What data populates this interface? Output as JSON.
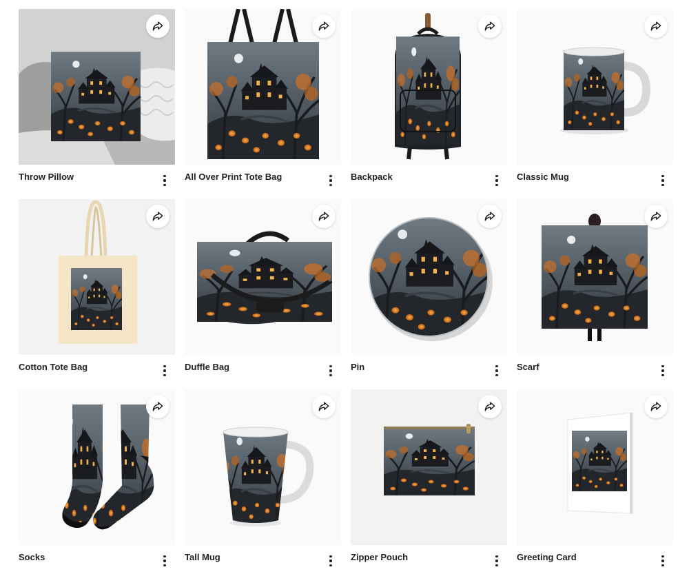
{
  "theme": {
    "title_color": "#222222",
    "art_sky": "#5b6670",
    "art_dark": "#1d1f24",
    "art_orange": "#e07a1f",
    "art_window": "#f2b24a"
  },
  "products": [
    {
      "title": "Throw Pillow",
      "share_icon": "share-arrow-icon",
      "menu_icon": "more-vertical-icon"
    },
    {
      "title": "All Over Print Tote Bag",
      "share_icon": "share-arrow-icon",
      "menu_icon": "more-vertical-icon"
    },
    {
      "title": "Backpack",
      "share_icon": "share-arrow-icon",
      "menu_icon": "more-vertical-icon"
    },
    {
      "title": "Classic Mug",
      "share_icon": "share-arrow-icon",
      "menu_icon": "more-vertical-icon"
    },
    {
      "title": "Cotton Tote Bag",
      "share_icon": "share-arrow-icon",
      "menu_icon": "more-vertical-icon"
    },
    {
      "title": "Duffle Bag",
      "share_icon": "share-arrow-icon",
      "menu_icon": "more-vertical-icon"
    },
    {
      "title": "Pin",
      "share_icon": "share-arrow-icon",
      "menu_icon": "more-vertical-icon"
    },
    {
      "title": "Scarf",
      "share_icon": "share-arrow-icon",
      "menu_icon": "more-vertical-icon"
    },
    {
      "title": "Socks",
      "share_icon": "share-arrow-icon",
      "menu_icon": "more-vertical-icon"
    },
    {
      "title": "Tall Mug",
      "share_icon": "share-arrow-icon",
      "menu_icon": "more-vertical-icon"
    },
    {
      "title": "Zipper Pouch",
      "share_icon": "share-arrow-icon",
      "menu_icon": "more-vertical-icon"
    },
    {
      "title": "Greeting Card",
      "share_icon": "share-arrow-icon",
      "menu_icon": "more-vertical-icon"
    }
  ]
}
